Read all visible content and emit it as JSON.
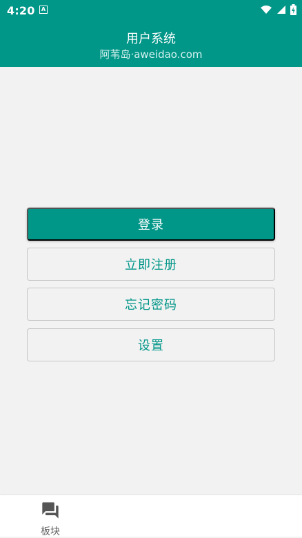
{
  "status_bar": {
    "time": "4:20",
    "notification_badge": "A",
    "icons": [
      "wifi-icon",
      "signal-icon",
      "battery-icon"
    ]
  },
  "app_bar": {
    "title": "用户系统",
    "subtitle": "阿苇岛·aweidao.com"
  },
  "buttons": {
    "login": "登录",
    "register": "立即注册",
    "forgot_password": "忘记密码",
    "settings": "设置"
  },
  "bottom_nav": {
    "items": [
      {
        "label": "板块",
        "icon": "forum-icon"
      }
    ]
  },
  "colors": {
    "primary": "#009688",
    "background": "#f2f2f2",
    "outline": "#c6c6c6",
    "nav_text": "#666666"
  }
}
